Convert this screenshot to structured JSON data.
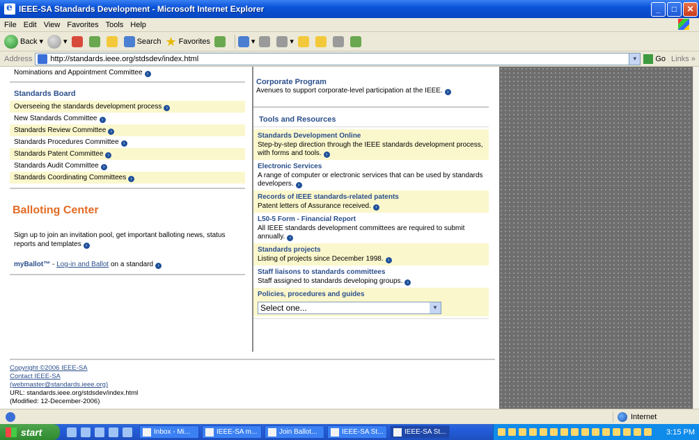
{
  "window": {
    "title": "IEEE-SA Standards Development - Microsoft Internet Explorer"
  },
  "menu": [
    "File",
    "Edit",
    "View",
    "Favorites",
    "Tools",
    "Help"
  ],
  "toolbar": {
    "back_label": "Back",
    "search_label": "Search",
    "favorites_label": "Favorites"
  },
  "address": {
    "label": "Address",
    "url": "http://standards.ieee.org/stdsdev/index.html",
    "go_label": "Go",
    "links_label": "Links"
  },
  "left": {
    "nominations": "Nominations and Appointment Committee",
    "standards_board_heading": "Standards Board",
    "board_items": [
      "Overseeing the standards development process",
      "New Standards Committee",
      "Standards Review Committee",
      "Standards Procedures Committee",
      "Standards Patent Committee",
      "Standards Audit Committee",
      "Standards Coordinating Committees"
    ],
    "balloting_heading": "Balloting Center",
    "balloting_text": "Sign up to join an invitation pool, get important balloting news, status reports and templates",
    "myballot_label": "myBallot™",
    "myballot_sep": " - ",
    "myballot_link": "Log-in and Ballot",
    "myballot_suffix": " on a standard"
  },
  "right": {
    "corporate_heading": "Corporate Program",
    "corporate_text": "Avenues to support corporate-level participation at the IEEE.",
    "tools_heading": "Tools and Resources",
    "resources": [
      {
        "title": "Standards Development Online",
        "desc": "Step-by-step direction through the IEEE standards development process, with forms and tools."
      },
      {
        "title": "Electronic Services",
        "desc": "A range of computer or electronic services that can be used by standards developers."
      },
      {
        "title": "Records of IEEE standards-related patents",
        "desc": "Patent letters of Assurance received."
      },
      {
        "title": "L50-5 Form - Financial Report",
        "desc": "All IEEE standards development committees are required to submit annually."
      },
      {
        "title": "Standards projects",
        "desc": "Listing of projects since December 1998."
      },
      {
        "title": "Staff liaisons to standards committees",
        "desc": "Staff assigned to standards developing groups."
      }
    ],
    "policies_heading": "Policies, procedures and guides",
    "policies_select": "Select one..."
  },
  "footer": {
    "copyright": "Copyright ©2006 IEEE-SA",
    "contact": "Contact IEEE-SA",
    "email": "(webmaster@standards.ieee.org)",
    "url": "URL: standards.ieee.org/stdsdev/index.html",
    "modified": "(Modified: 12-December-2006)"
  },
  "status": {
    "zone": "Internet"
  },
  "taskbar": {
    "start": "start",
    "tasks": [
      "Inbox - Mi...",
      "IEEE-SA m...",
      "Join Ballot...",
      "IEEE-SA St...",
      "IEEE-SA St..."
    ],
    "clock": "3:15 PM"
  }
}
